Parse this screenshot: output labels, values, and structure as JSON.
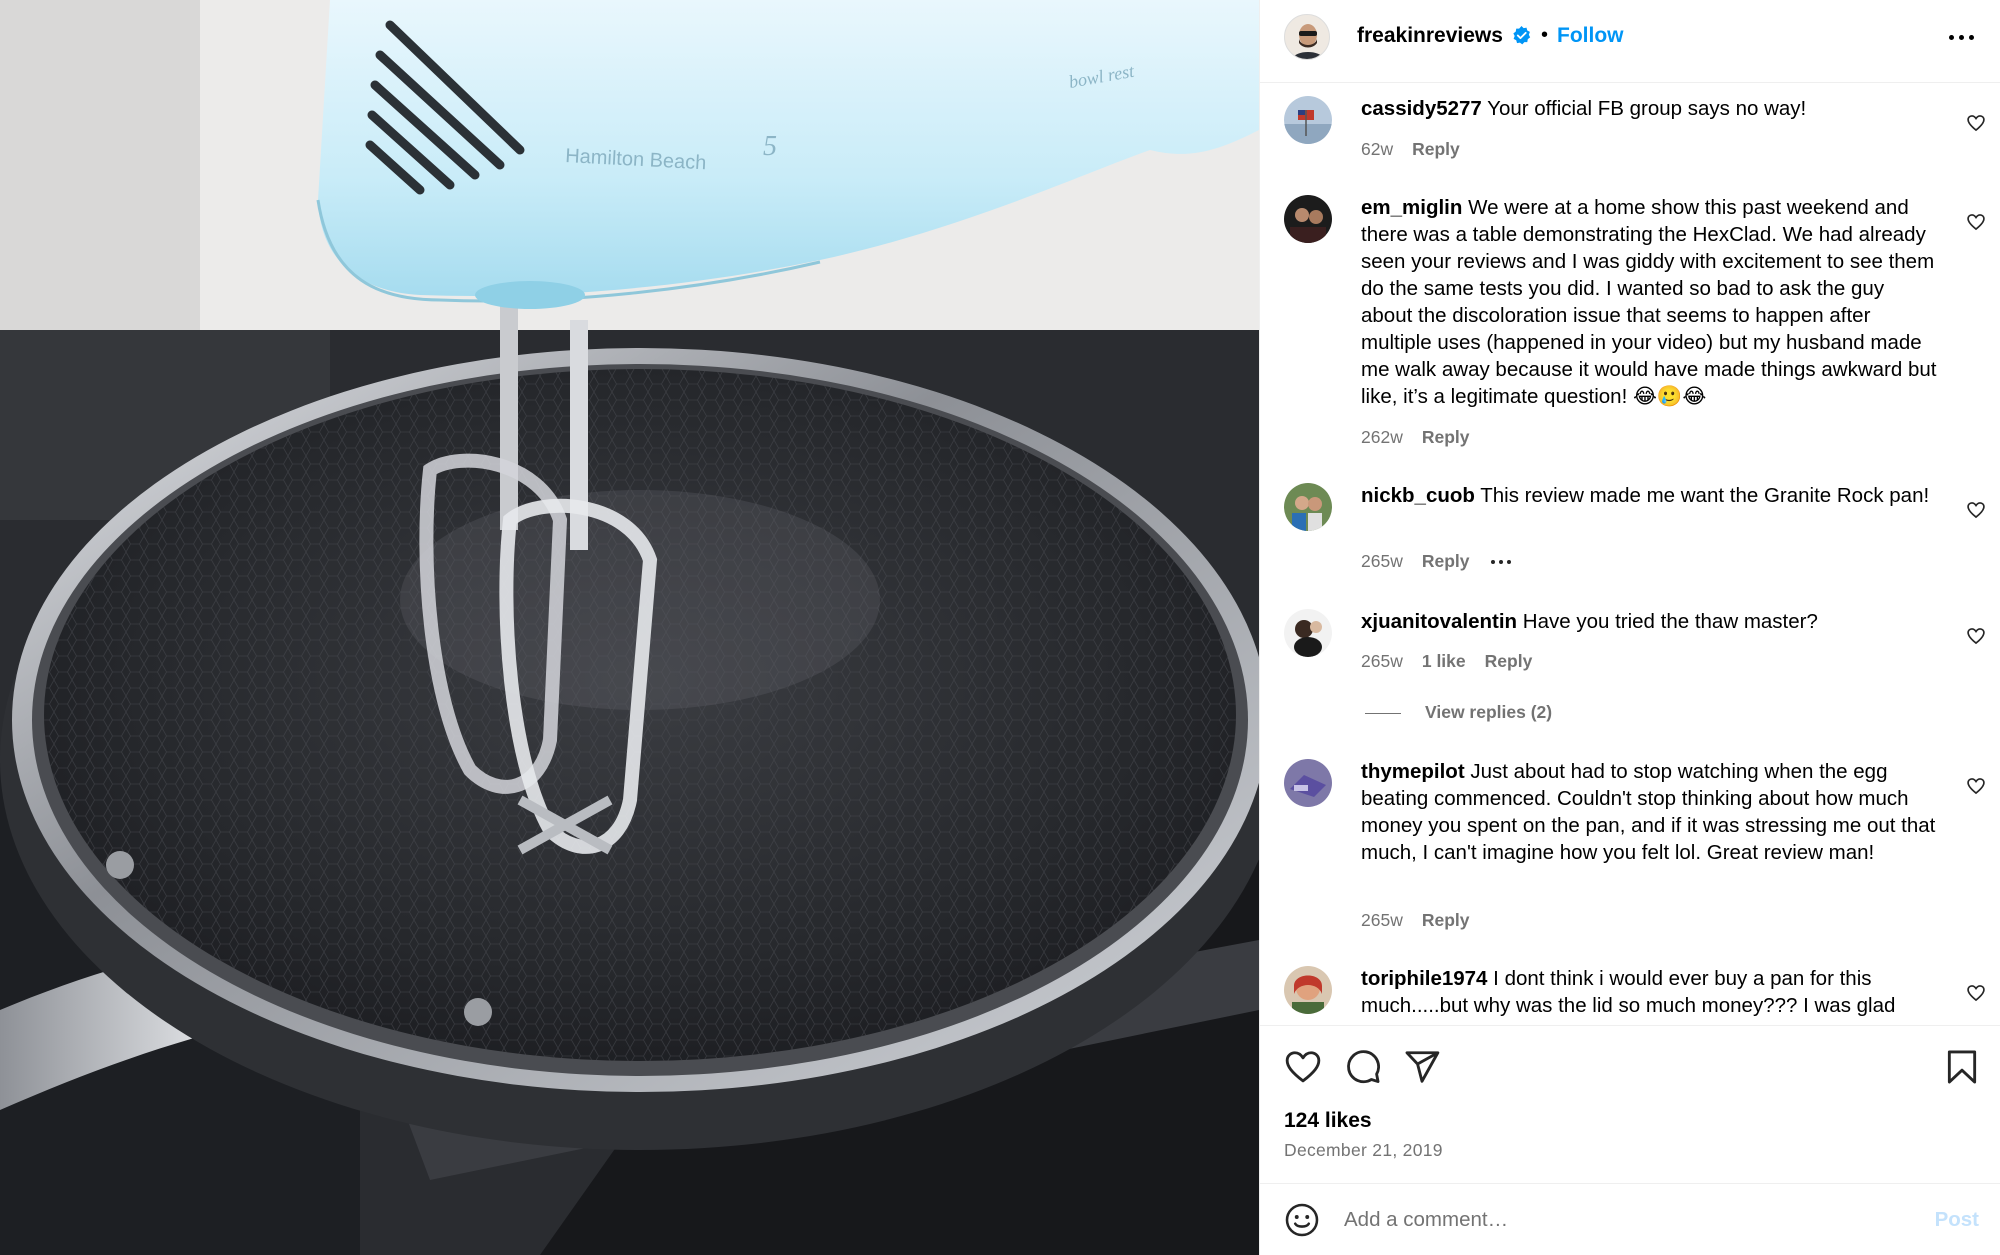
{
  "post": {
    "author": "freakinreviews",
    "verified": true,
    "follow_label": "Follow",
    "separator": "•",
    "likes": "124 likes",
    "date": "December 21, 2019",
    "image_text": {
      "mixer_brand": "Hamilton Beach",
      "mixer_model_mark": "5",
      "mixer_side_text": "bowl rest"
    }
  },
  "comments": [
    {
      "user": "cassidy5277",
      "text": "Your official FB group says no way!",
      "age": "62w",
      "reply_label": "Reply"
    },
    {
      "user": "em_miglin",
      "text": "We were at a home show this past weekend and there was a table demonstrating the HexClad. We had already seen your reviews and I was giddy with excitement to see them do the same tests you did. I wanted so bad to ask the guy about the discoloration issue that seems to happen after multiple uses (happened in your video) but my husband made me walk away because it would have made things awkward but like, it’s a legitimate question! 😂🥲😂",
      "age": "262w",
      "reply_label": "Reply"
    },
    {
      "user": "nickb_cuob",
      "text": "This review made me want the Granite Rock pan!",
      "age": "265w",
      "reply_label": "Reply"
    },
    {
      "user": "xjuanitovalentin",
      "text": "Have you tried the thaw master?",
      "age": "265w",
      "likes": "1 like",
      "reply_label": "Reply",
      "view_replies": "View replies (2)"
    },
    {
      "user": "thymepilot",
      "text": "Just about had to stop watching when the egg beating commenced. Couldn't stop thinking about how much money you spent on the pan, and if it was stressing me out that much, I can't imagine how you felt lol. Great review man!",
      "age": "265w",
      "reply_label": "Reply"
    },
    {
      "user": "toriphile1974",
      "text": "I dont think i would ever buy a pan for this much.....but why was the lid so much money??? I was glad",
      "age": "",
      "reply_label": ""
    }
  ],
  "add_comment": {
    "placeholder": "Add a comment…",
    "post_label": "Post"
  },
  "icons": {
    "like": "heart-icon",
    "comment": "comment-bubble-icon",
    "share": "paper-plane-icon",
    "save": "bookmark-icon",
    "emoji": "smiley-icon",
    "more": "more-horizontal-icon",
    "verified": "verified-badge-icon"
  },
  "colors": {
    "link_blue": "#0095f6",
    "muted_text": "#737373",
    "post_disabled": "#c4e2fc"
  }
}
